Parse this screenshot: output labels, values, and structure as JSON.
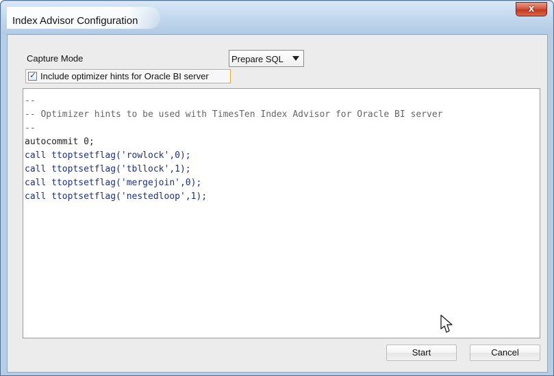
{
  "window": {
    "title": "Index Advisor Configuration",
    "close_label": "x"
  },
  "capture": {
    "label": "Capture Mode",
    "selected": "Prepare SQL"
  },
  "optimizer_hints": {
    "checked": true,
    "label": "Include optimizer hints for Oracle BI server"
  },
  "code": {
    "lines": [
      "--",
      "-- Optimizer hints to be used with TimesTen Index Advisor for Oracle BI server",
      "--",
      "autocommit 0;",
      "call ttoptsetflag('rowlock',0);",
      "call ttoptsetflag('tbllock',1);",
      "call ttoptsetflag('mergejoin',0);",
      "call ttoptsetflag('nestedloop',1);"
    ]
  },
  "footer": {
    "start_label": "Start",
    "cancel_label": "Cancel"
  },
  "colors": {
    "title_bar": "#c8dcef",
    "close_button": "#c2381d",
    "checkbox_focus": "#f2a437",
    "keyword": "#1b2f86",
    "string": "#1f5a82",
    "comment": "#666666"
  },
  "icons": {
    "cursor": "mouse-pointer-icon",
    "dropdown": "chevron-down-icon",
    "close": "close-icon",
    "checkbox": "check-icon"
  }
}
